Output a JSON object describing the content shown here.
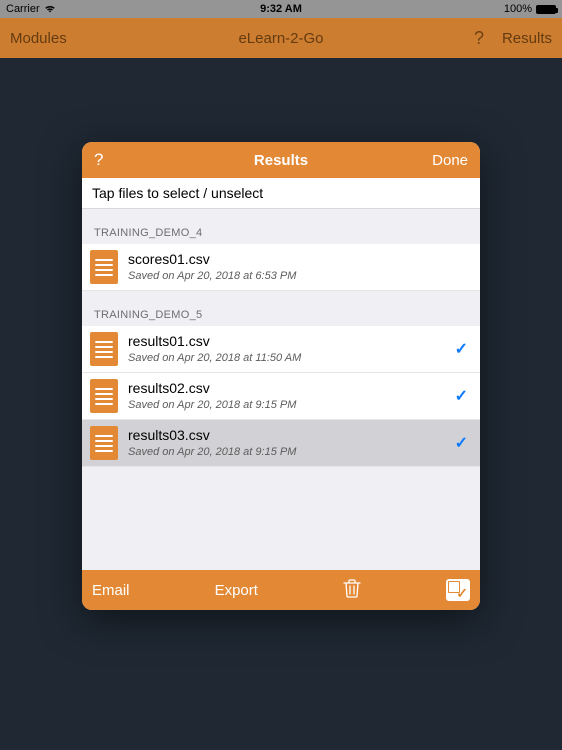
{
  "status": {
    "carrier": "Carrier",
    "time": "9:32 AM",
    "battery_pct": "100%"
  },
  "navbar": {
    "left": "Modules",
    "title": "eLearn-2-Go",
    "help_glyph": "?",
    "right": "Results"
  },
  "modal": {
    "help_glyph": "?",
    "title": "Results",
    "done": "Done",
    "instruction": "Tap files to select / unselect",
    "sections": [
      {
        "header": "TRAINING_DEMO_4",
        "rows": [
          {
            "name": "scores01.csv",
            "subtitle": "Saved on Apr 20, 2018 at 6:53 PM",
            "checked": false,
            "highlight": false
          }
        ]
      },
      {
        "header": "TRAINING_DEMO_5",
        "rows": [
          {
            "name": "results01.csv",
            "subtitle": "Saved on Apr 20, 2018 at 11:50 AM",
            "checked": true,
            "highlight": false
          },
          {
            "name": "results02.csv",
            "subtitle": "Saved on Apr 20, 2018 at 9:15 PM",
            "checked": true,
            "highlight": false
          },
          {
            "name": "results03.csv",
            "subtitle": "Saved on Apr 20, 2018 at 9:15 PM",
            "checked": true,
            "highlight": true
          }
        ]
      }
    ],
    "footer": {
      "email": "Email",
      "export": "Export"
    }
  },
  "colors": {
    "accent": "#e38935",
    "bg": "#1f2833"
  }
}
